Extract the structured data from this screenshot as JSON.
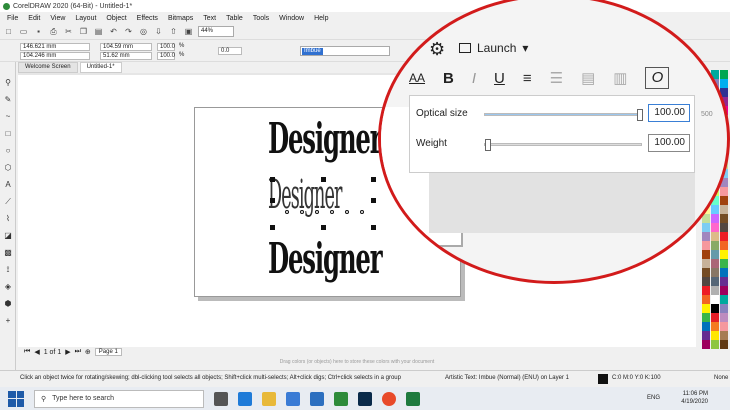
{
  "window": {
    "title": "CorelDRAW 2020 (64-Bit) - Untitled-1*"
  },
  "menu": [
    "File",
    "Edit",
    "View",
    "Layout",
    "Object",
    "Effects",
    "Bitmaps",
    "Text",
    "Table",
    "Tools",
    "Window",
    "Help"
  ],
  "toolbar": {
    "zoom": "44%"
  },
  "properties": {
    "x": "146.621 mm",
    "y": "104.246 mm",
    "w": "104.59 mm",
    "h": "51.62 mm",
    "scale_w": "100.0",
    "scale_h": "100.0",
    "scale_unit": "%",
    "angle": "0.0",
    "font": "Imbue"
  },
  "tabs": [
    "Welcome Screen",
    "Untitled-1*"
  ],
  "canvas": {
    "words": [
      "Designer",
      "Designer",
      "Designer"
    ]
  },
  "pagebar": {
    "page_label": "Page 1",
    "page_count": "1 of 1"
  },
  "colordock": {
    "hint": "Drag colors (or objects) here to store these colors with your document"
  },
  "zoom_callout": {
    "launch_label": "Launch",
    "format_buttons": [
      "B",
      "I",
      "U"
    ],
    "variable_font_button": "O",
    "font_size_icon": "AA",
    "panel": {
      "optical_size_label": "Optical size",
      "optical_size_value": "100.00",
      "optical_size_fraction": 1.0,
      "weight_label": "Weight",
      "weight_value": "100.00",
      "weight_fraction": 0.0
    },
    "ruler_tick": "500"
  },
  "statusbar": {
    "hint": "Click an object twice for rotating/skewing; dbl-clicking tool selects all objects; Shift+click multi-selects; Alt+click digs; Ctrl+click selects in a group",
    "object_info": "Artistic Text: Imbue (Normal) (ENU) on Layer 1",
    "fill_info": "C:0 M:0 Y:0 K:100",
    "outline_info": "None"
  },
  "taskbar": {
    "search_placeholder": "Type here to search",
    "time": "11:06 PM",
    "date": "4/19/2020",
    "lang": "ENG"
  },
  "colors": {
    "accent_red": "#d21b1b",
    "selection_blue": "#3070d0",
    "slider_fill": "#9cc7ee"
  }
}
